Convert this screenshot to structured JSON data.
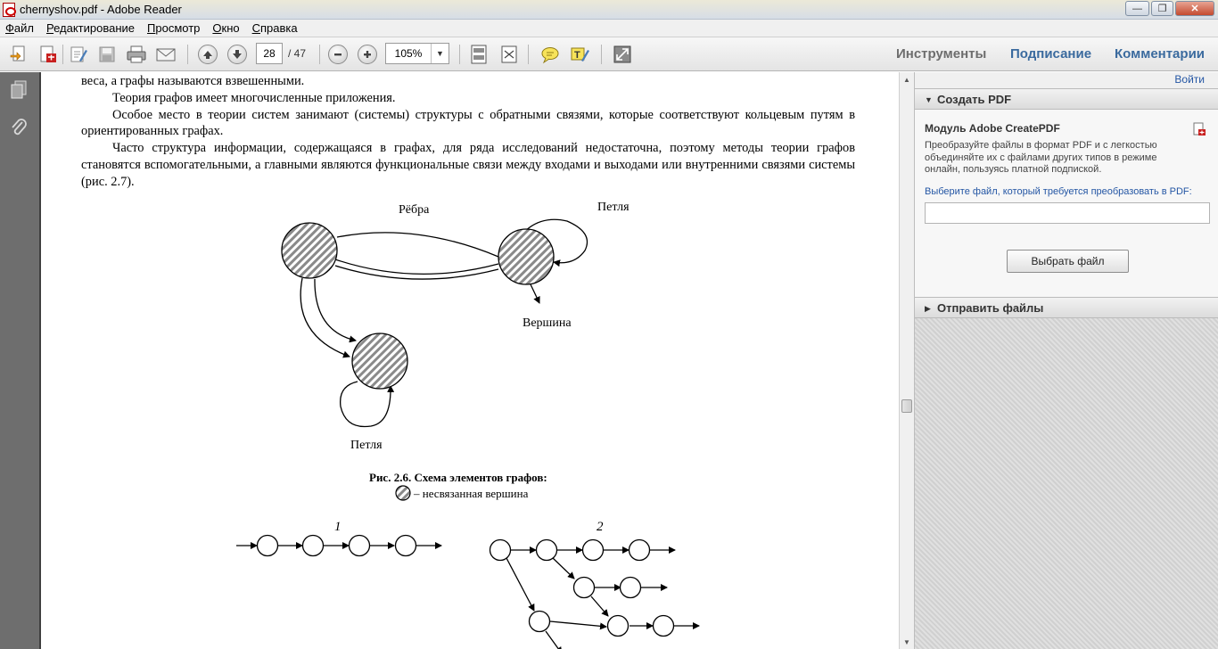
{
  "window": {
    "title": "chernyshov.pdf - Adobe Reader",
    "controls": {
      "minimize": "—",
      "maximize": "❐",
      "close": "✕"
    }
  },
  "menu": {
    "items": [
      {
        "label": "Файл",
        "accel": "Ф",
        "rest": "айл"
      },
      {
        "label": "Редактирование",
        "accel": "Р",
        "rest": "едактирование"
      },
      {
        "label": "Просмотр",
        "accel": "П",
        "rest": "росмотр"
      },
      {
        "label": "Окно",
        "accel": "О",
        "rest": "кно"
      },
      {
        "label": "Справка",
        "accel": "С",
        "rest": "правка"
      }
    ]
  },
  "toolbar": {
    "page_current": "28",
    "page_total": "/ 47",
    "zoom": "105%",
    "zoom_arrow": "▼",
    "tabs": {
      "tools": "Инструменты",
      "sign": "Подписание",
      "comments": "Комментарии"
    },
    "icons": [
      "open-icon",
      "create-pdf-icon",
      "edit-icon",
      "save-icon",
      "print-icon",
      "email-icon",
      "prev-page-icon",
      "next-page-icon",
      "zoom-out-icon",
      "zoom-in-icon",
      "fit-page-icon",
      "fullscreen-icon",
      "comment-icon",
      "highlight-icon",
      "expand-icon"
    ]
  },
  "document": {
    "paragraphs": [
      "веса, а графы называются взвешенными.",
      "Теория графов имеет многочисленные приложения.",
      "Особое место в теории систем занимают (системы) структуры с обратными связями, которые соответствуют кольцевым путям в ориентированных графах.",
      "Часто структура информации, содержащаяся в графах, для ряда исследований недостаточна, поэтому методы теории графов становятся вспомогательными, а главными являются функциональные связи между входами и выходами или внутренними связями системы (рис. 2.7)."
    ],
    "figure_labels": {
      "edges": "Рёбра",
      "loop_top": "Петля",
      "vertex": "Вершина",
      "loop_bottom": "Петля"
    },
    "caption": {
      "title": "Рис. 2.6. Схема элементов графов:",
      "legend": "– несвязанная вершина"
    },
    "figure2_labels": {
      "left": "1",
      "right": "2"
    }
  },
  "right_pane": {
    "login": "Войти",
    "create_pdf": {
      "header": "Создать PDF",
      "module_title": "Модуль Adobe CreatePDF",
      "description": "Преобразуйте файлы в формат PDF и с легкостью объединяйте их с файлами других типов в режиме онлайн, пользуясь платной подпиской.",
      "select_prompt": "Выберите файл, который требуется преобразовать в PDF:",
      "select_button": "Выбрать файл",
      "input_value": ""
    },
    "send_files": {
      "header": "Отправить файлы"
    }
  },
  "colors": {
    "nav_bg": "#6e6e6e",
    "link": "#2456a4",
    "tab_blue": "#3a6a9e"
  }
}
